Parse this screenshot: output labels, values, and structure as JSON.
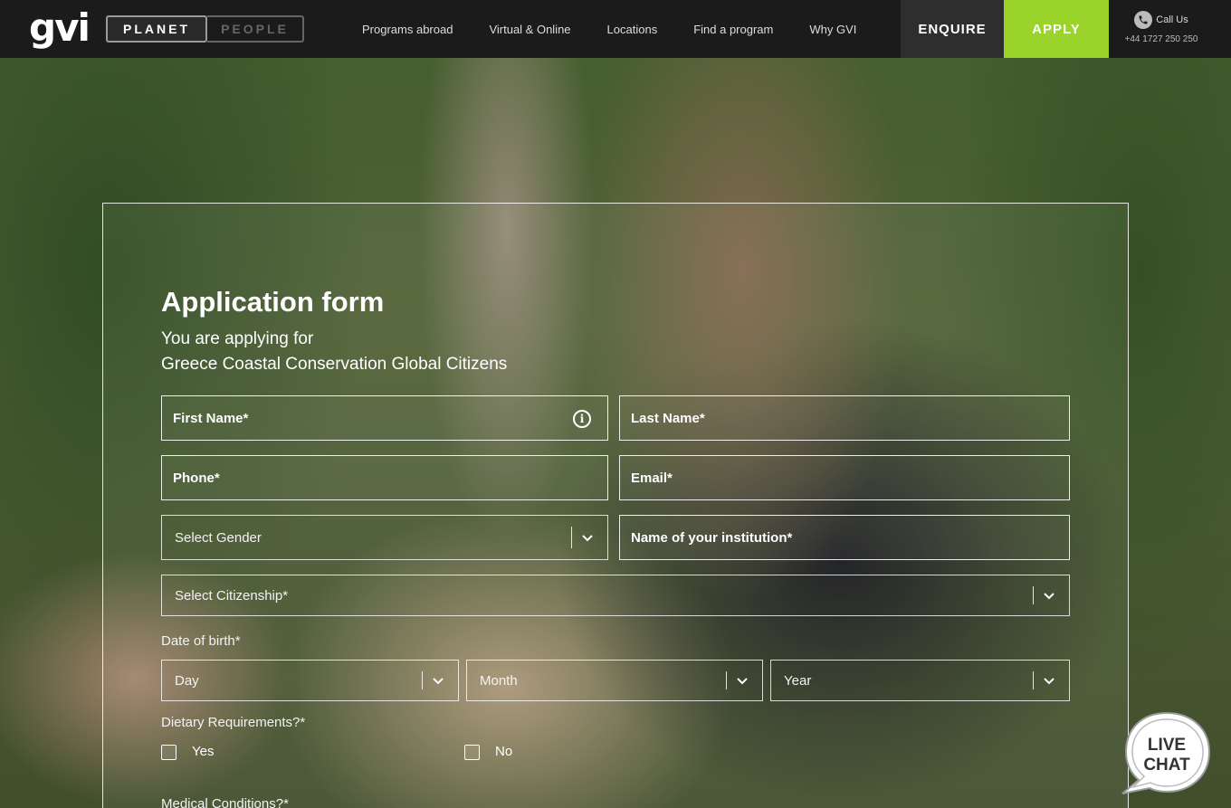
{
  "header": {
    "logo": "gvi",
    "toggle": {
      "active": "PLANET",
      "inactive": "PEOPLE"
    },
    "nav": [
      "Programs abroad",
      "Virtual & Online",
      "Locations",
      "Find a program",
      "Why GVI"
    ],
    "enquire": "ENQUIRE",
    "apply": "APPLY",
    "call_label": "Call Us",
    "call_number": "+44 1727 250 250"
  },
  "form": {
    "title": "Application form",
    "subtitle_line1": "You are applying for",
    "subtitle_line2": "Greece Coastal Conservation Global Citizens",
    "first_name": "First Name*",
    "last_name": "Last Name*",
    "phone": "Phone*",
    "email": "Email*",
    "gender": "Select Gender",
    "institution": "Name of your institution*",
    "citizenship": "Select Citizenship*",
    "dob_label": "Date of birth*",
    "dob_day": "Day",
    "dob_month": "Month",
    "dob_year": "Year",
    "dietary_label": "Dietary Requirements?*",
    "yes": "Yes",
    "no": "No",
    "medical_label": "Medical Conditions?*"
  },
  "livechat": {
    "line1": "LIVE",
    "line2": "CHAT"
  },
  "colors": {
    "apply_green": "#9ad42a",
    "header_bg": "#1b1b1b",
    "enquire_bg": "#2e2e2e"
  }
}
